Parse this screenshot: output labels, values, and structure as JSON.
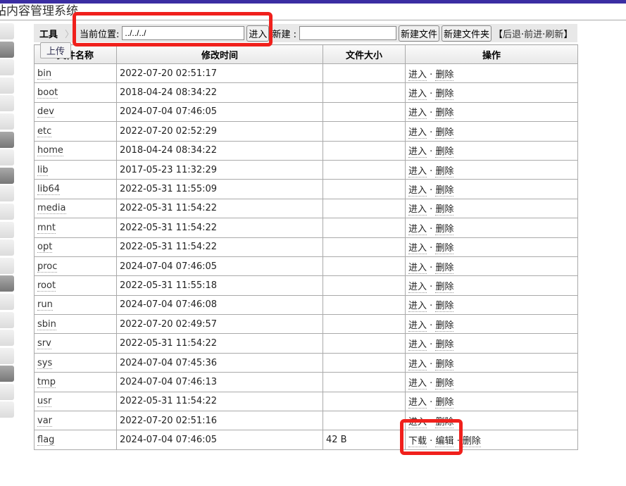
{
  "app_title": "站内容管理系统",
  "toolbar": {
    "tools_label": "工具",
    "location_label": "当前位置:",
    "location_value": "../../../",
    "enter_button": "进入",
    "new_label": "新建 :",
    "new_value": "",
    "new_file_button": "新建文件",
    "new_folder_button": "新建文件夹",
    "nav_open": "【",
    "back": "后退",
    "forward": "前进",
    "refresh": "刷新",
    "nav_close": "】",
    "dot": "·"
  },
  "upload_button": "上传",
  "table": {
    "headers": [
      "文件名称",
      "修改时间",
      "文件大小",
      "操作"
    ],
    "rows": [
      {
        "name": "bin",
        "time": "2022-07-20 02:51:17",
        "size": "",
        "actions": [
          "进入",
          "删除"
        ]
      },
      {
        "name": "boot",
        "time": "2018-04-24 08:34:22",
        "size": "",
        "actions": [
          "进入",
          "删除"
        ]
      },
      {
        "name": "dev",
        "time": "2024-07-04 07:46:05",
        "size": "",
        "actions": [
          "进入",
          "删除"
        ]
      },
      {
        "name": "etc",
        "time": "2022-07-20 02:52:29",
        "size": "",
        "actions": [
          "进入",
          "删除"
        ]
      },
      {
        "name": "home",
        "time": "2018-04-24 08:34:22",
        "size": "",
        "actions": [
          "进入",
          "删除"
        ]
      },
      {
        "name": "lib",
        "time": "2017-05-23 11:32:29",
        "size": "",
        "actions": [
          "进入",
          "删除"
        ]
      },
      {
        "name": "lib64",
        "time": "2022-05-31 11:55:09",
        "size": "",
        "actions": [
          "进入",
          "删除"
        ]
      },
      {
        "name": "media",
        "time": "2022-05-31 11:54:22",
        "size": "",
        "actions": [
          "进入",
          "删除"
        ]
      },
      {
        "name": "mnt",
        "time": "2022-05-31 11:54:22",
        "size": "",
        "actions": [
          "进入",
          "删除"
        ]
      },
      {
        "name": "opt",
        "time": "2022-05-31 11:54:22",
        "size": "",
        "actions": [
          "进入",
          "删除"
        ]
      },
      {
        "name": "proc",
        "time": "2024-07-04 07:46:05",
        "size": "",
        "actions": [
          "进入",
          "删除"
        ]
      },
      {
        "name": "root",
        "time": "2022-05-31 11:55:18",
        "size": "",
        "actions": [
          "进入",
          "删除"
        ]
      },
      {
        "name": "run",
        "time": "2024-07-04 07:46:08",
        "size": "",
        "actions": [
          "进入",
          "删除"
        ]
      },
      {
        "name": "sbin",
        "time": "2022-07-20 02:49:57",
        "size": "",
        "actions": [
          "进入",
          "删除"
        ]
      },
      {
        "name": "srv",
        "time": "2022-05-31 11:54:22",
        "size": "",
        "actions": [
          "进入",
          "删除"
        ]
      },
      {
        "name": "sys",
        "time": "2024-07-04 07:45:36",
        "size": "",
        "actions": [
          "进入",
          "删除"
        ]
      },
      {
        "name": "tmp",
        "time": "2024-07-04 07:46:13",
        "size": "",
        "actions": [
          "进入",
          "删除"
        ]
      },
      {
        "name": "usr",
        "time": "2022-05-31 11:54:22",
        "size": "",
        "actions": [
          "进入",
          "删除"
        ]
      },
      {
        "name": "var",
        "time": "2022-07-20 02:51:16",
        "size": "",
        "actions": [
          "进入",
          "删除"
        ]
      },
      {
        "name": "flag",
        "time": "2024-07-04 07:46:05",
        "size": "42 B",
        "actions": [
          "下载",
          "编辑",
          "删除"
        ]
      }
    ]
  },
  "colors": {
    "annotation": "#f0201c",
    "topbar": "#3b2ea3"
  }
}
